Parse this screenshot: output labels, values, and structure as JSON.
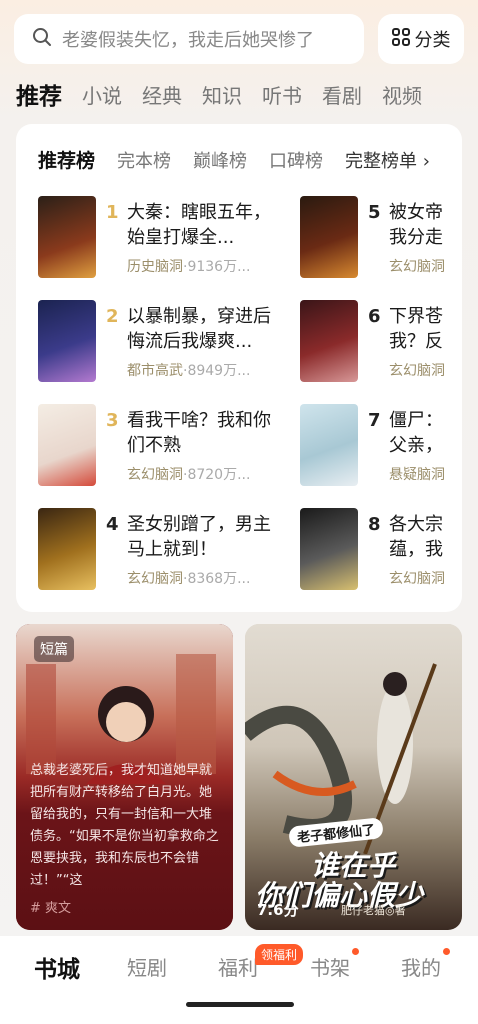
{
  "search": {
    "placeholder": "老婆假装失忆，我走后她哭惨了",
    "category_label": "分类"
  },
  "tabs": [
    "推荐",
    "小说",
    "经典",
    "知识",
    "听书",
    "看剧",
    "视频"
  ],
  "ranking": {
    "tabs": [
      "推荐榜",
      "完本榜",
      "巅峰榜",
      "口碑榜"
    ],
    "full_list_label": "完整榜单",
    "books": [
      {
        "rank": "1",
        "title": "大秦：瞎眼五年，始皇打爆全...",
        "category": "历史脑洞",
        "count": "·9136万..."
      },
      {
        "rank": "2",
        "title": "以暴制暴，穿进后悔流后我爆爽...",
        "category": "都市高武",
        "count": "·8949万..."
      },
      {
        "rank": "3",
        "title": "看我干啥？我和你们不熟",
        "category": "玄幻脑洞",
        "count": "·8720万..."
      },
      {
        "rank": "4",
        "title": "圣女别蹭了，男主马上就到！",
        "category": "玄幻脑洞",
        "count": "·8368万..."
      },
      {
        "rank": "5",
        "title": "被女帝",
        "title2": "我分走",
        "category": "玄幻脑洞",
        "count": ""
      },
      {
        "rank": "6",
        "title": "下界苍",
        "title2": "我？反",
        "category": "玄幻脑洞",
        "count": ""
      },
      {
        "rank": "7",
        "title": "僵尸：",
        "title2": "父亲，",
        "category": "悬疑脑洞",
        "count": ""
      },
      {
        "rank": "8",
        "title": "各大宗",
        "title2": "蕴，我",
        "category": "玄幻脑洞",
        "count": ""
      }
    ]
  },
  "short_card": {
    "badge": "短篇",
    "text": "总裁老婆死后，我才知道她早就把所有财产转移给了白月光。她留给我的，只有一封信和一大堆债务。“如果不是你当初拿救命之恩要挟我，我和东辰也不会错过！”“这",
    "tag": "# 爽文"
  },
  "novel_card": {
    "top_line": "老子都修仙了",
    "main_title_1": "谁在乎",
    "main_title_2": "你们偏心假少",
    "score": "7.6分",
    "author": "肥仔老猫◎著"
  },
  "bottom_nav": {
    "items": [
      "书城",
      "短剧",
      "福利",
      "书架",
      "我的"
    ],
    "welfare_badge": "领福利"
  },
  "colors": {
    "rank_gold": "#e0b55a",
    "accent": "#ff5a2a",
    "meta": "#9b8e6a"
  }
}
